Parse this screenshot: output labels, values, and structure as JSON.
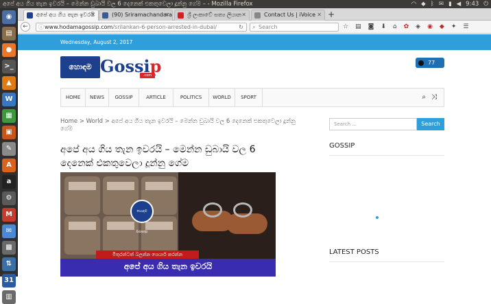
{
  "os": {
    "window_title": "අපේ අය ගිය තැන ඉවරයි – මෙන්න ඩුබායි වල 6 දෙනෙක් එකතුවෙලා දූන්නු ගේම – - Mozilla Firefox",
    "time": "9:43",
    "tray_icons": [
      "wifi-icon",
      "dropbox-icon",
      "bluetooth-icon",
      "mail-icon",
      "battery-icon",
      "volume-icon"
    ]
  },
  "launcher": {
    "items": [
      {
        "name": "dash-icon",
        "glyph": "◉",
        "color": "#4a6fa5"
      },
      {
        "name": "files-icon",
        "glyph": "▤",
        "color": "#8a6d4a"
      },
      {
        "name": "firefox-icon",
        "glyph": "●",
        "color": "#e8762b"
      },
      {
        "name": "terminal-icon",
        "glyph": ">_",
        "color": "#555555"
      },
      {
        "name": "vlc-icon",
        "glyph": "▲",
        "color": "#e07b14"
      },
      {
        "name": "writer-icon",
        "glyph": "W",
        "color": "#3a77c2"
      },
      {
        "name": "calc-icon",
        "glyph": "▦",
        "color": "#3c9a3c"
      },
      {
        "name": "impress-icon",
        "glyph": "▣",
        "color": "#c9551a"
      },
      {
        "name": "text-editor-icon",
        "glyph": "✎",
        "color": "#8a8a8a"
      },
      {
        "name": "software-center-icon",
        "glyph": "A",
        "color": "#d9621c"
      },
      {
        "name": "amazon-icon",
        "glyph": "a",
        "color": "#222222"
      },
      {
        "name": "settings-icon",
        "glyph": "⚙",
        "color": "#5a5a5a"
      },
      {
        "name": "gmail-icon",
        "glyph": "M",
        "color": "#c53b2c"
      },
      {
        "name": "chat-icon",
        "glyph": "✉",
        "color": "#4a8ad4"
      },
      {
        "name": "screenshot-icon",
        "glyph": "▩",
        "color": "#6a6a6a"
      },
      {
        "name": "network-icon",
        "glyph": "⇅",
        "color": "#3a6fa8"
      },
      {
        "name": "calendar-icon",
        "glyph": "31",
        "color": "#2a5aa0"
      },
      {
        "name": "workspace-icon",
        "glyph": "▥",
        "color": "#6a6a6a"
      }
    ]
  },
  "browser": {
    "tabs": [
      {
        "label": "අපේ අය ගිය තැන ඉවරයි",
        "favicon_color": "#1c3f8e",
        "active": true
      },
      {
        "label": "(90) Sriramachandaran",
        "favicon_color": "#3b5998",
        "active": false
      },
      {
        "label": "ශ්‍රී ලංකාවේ සත්‍ය ලියාන",
        "favicon_color": "#cc2222",
        "active": false
      },
      {
        "label": "Contact Us | iVoice",
        "favicon_color": "#888888",
        "active": false
      }
    ],
    "url_domain": "www.hodamagossip.com",
    "url_path": "/srilankan-6-person-arrested-in-dubai/",
    "search_placeholder": "Search"
  },
  "site": {
    "date": "Wednesday, August 2, 2017",
    "logo": {
      "sinhala": "හොඳම",
      "word_main": "Gossi",
      "word_end": "p",
      "com": ".com"
    },
    "fb_count": "77",
    "menu": [
      "HOME",
      "NEWS",
      "GOSSIP",
      "ARTICLE",
      "POLITICS",
      "WORLD",
      "SPORT"
    ],
    "breadcrumb": [
      "Home",
      ">",
      "World",
      ">",
      "අපේ අය ගිය තැන ඉවරයි – මෙන්න ඩුබායි වල 6 දෙනෙක් එකතුවෙලා දූන්නු ගේම"
    ],
    "headline": "අපේ අය ගිය තැන ඉවරයි – මෙන්න ඩුබායි වල 6 දෙනෙක් එකතුවෙලා දූන්නු ගේම",
    "image": {
      "ribbon": "මිතුරන්ටත් බලන්න ශෙයාර් කරන්න",
      "banner": "අපේ අය ගිය තැන ඉවරයි",
      "badge": "හොඳම Gossip"
    },
    "sidebar": {
      "search_placeholder": "Search ...",
      "search_button": "Search",
      "gossip_heading": "GOSSIP",
      "latest_heading": "LATEST POSTS"
    }
  }
}
